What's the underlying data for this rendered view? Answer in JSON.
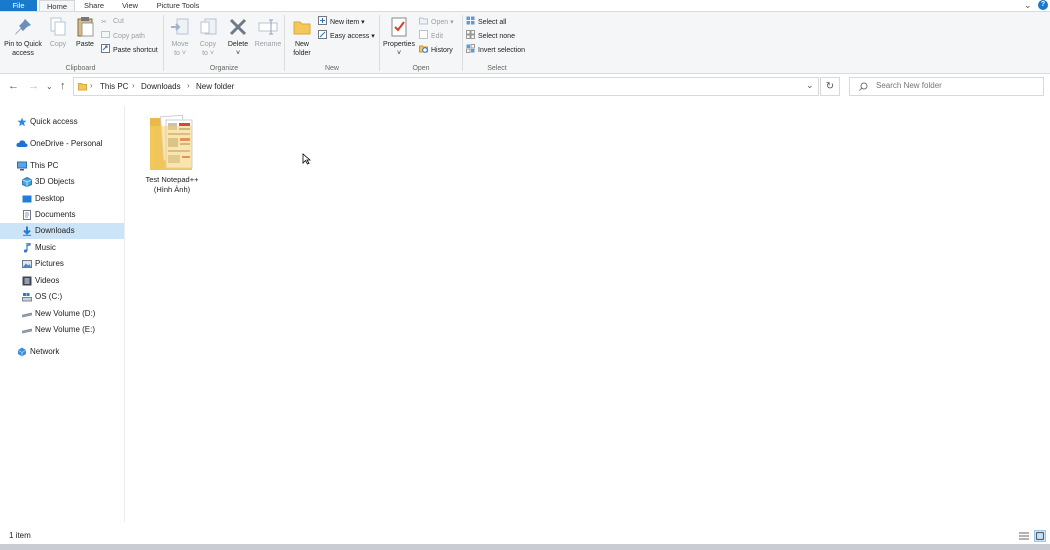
{
  "ribbon_tabs": [
    "File",
    "Home",
    "Share",
    "View",
    "Picture Tools"
  ],
  "window_controls": {
    "minimize": "—",
    "chevron": "⌄",
    "help": "?"
  },
  "clipboard": {
    "pin_label_1": "Pin to Quick",
    "pin_label_2": "access",
    "copy": "Copy",
    "paste": "Paste",
    "cut": "Cut",
    "copy_path": "Copy path",
    "paste_shortcut": "Paste shortcut",
    "group": "Clipboard"
  },
  "organize": {
    "move_to_1": "Move",
    "move_to_2": "to ˅",
    "copy_to_1": "Copy",
    "copy_to_2": "to ˅",
    "delete": "Delete",
    "delete_arrow": "˅",
    "rename": "Rename",
    "group": "Organize"
  },
  "new": {
    "new_folder_1": "New",
    "new_folder_2": "folder",
    "new_item": "New item ▾",
    "easy_access": "Easy access ▾",
    "group": "New"
  },
  "open": {
    "properties": "Properties",
    "properties_arrow": "˅",
    "open": "Open ▾",
    "edit": "Edit",
    "history": "History",
    "group": "Open"
  },
  "select": {
    "select_all": "Select all",
    "select_none": "Select none",
    "invert_selection": "Invert selection",
    "group": "Select"
  },
  "address": {
    "crumbs": [
      "This PC",
      "Downloads",
      "New folder"
    ],
    "search_placeholder": "Search New folder"
  },
  "nav": {
    "quick_access": "Quick access",
    "onedrive": "OneDrive - Personal",
    "this_pc": "This PC",
    "objects_3d": "3D Objects",
    "desktop": "Desktop",
    "documents": "Documents",
    "downloads": "Downloads",
    "music": "Music",
    "pictures": "Pictures",
    "videos": "Videos",
    "os_c": "OS (C:)",
    "vol_d": "New Volume (D:)",
    "vol_e": "New Volume (E:)",
    "network": "Network"
  },
  "files": [
    {
      "name_line1": "Test Notepad++",
      "name_line2": "(Hình Ảnh)",
      "icon": "folder-with-images-icon"
    }
  ],
  "status": {
    "item_count": "1 item"
  },
  "colors": {
    "accent": "#1979ca",
    "selected_bg": "#cce4f7",
    "ribbon_bg": "#f5f6f7"
  }
}
